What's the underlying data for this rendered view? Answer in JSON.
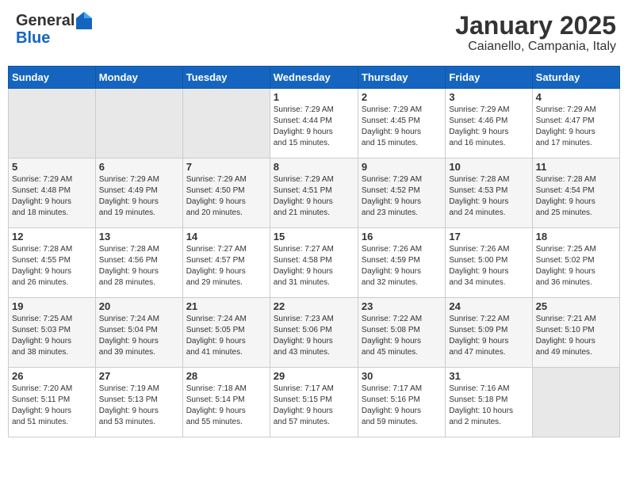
{
  "header": {
    "logo_general": "General",
    "logo_blue": "Blue",
    "title": "January 2025",
    "subtitle": "Caianello, Campania, Italy"
  },
  "calendar": {
    "days_of_week": [
      "Sunday",
      "Monday",
      "Tuesday",
      "Wednesday",
      "Thursday",
      "Friday",
      "Saturday"
    ],
    "weeks": [
      [
        {
          "day": "",
          "info": ""
        },
        {
          "day": "",
          "info": ""
        },
        {
          "day": "",
          "info": ""
        },
        {
          "day": "1",
          "info": "Sunrise: 7:29 AM\nSunset: 4:44 PM\nDaylight: 9 hours\nand 15 minutes."
        },
        {
          "day": "2",
          "info": "Sunrise: 7:29 AM\nSunset: 4:45 PM\nDaylight: 9 hours\nand 15 minutes."
        },
        {
          "day": "3",
          "info": "Sunrise: 7:29 AM\nSunset: 4:46 PM\nDaylight: 9 hours\nand 16 minutes."
        },
        {
          "day": "4",
          "info": "Sunrise: 7:29 AM\nSunset: 4:47 PM\nDaylight: 9 hours\nand 17 minutes."
        }
      ],
      [
        {
          "day": "5",
          "info": "Sunrise: 7:29 AM\nSunset: 4:48 PM\nDaylight: 9 hours\nand 18 minutes."
        },
        {
          "day": "6",
          "info": "Sunrise: 7:29 AM\nSunset: 4:49 PM\nDaylight: 9 hours\nand 19 minutes."
        },
        {
          "day": "7",
          "info": "Sunrise: 7:29 AM\nSunset: 4:50 PM\nDaylight: 9 hours\nand 20 minutes."
        },
        {
          "day": "8",
          "info": "Sunrise: 7:29 AM\nSunset: 4:51 PM\nDaylight: 9 hours\nand 21 minutes."
        },
        {
          "day": "9",
          "info": "Sunrise: 7:29 AM\nSunset: 4:52 PM\nDaylight: 9 hours\nand 23 minutes."
        },
        {
          "day": "10",
          "info": "Sunrise: 7:28 AM\nSunset: 4:53 PM\nDaylight: 9 hours\nand 24 minutes."
        },
        {
          "day": "11",
          "info": "Sunrise: 7:28 AM\nSunset: 4:54 PM\nDaylight: 9 hours\nand 25 minutes."
        }
      ],
      [
        {
          "day": "12",
          "info": "Sunrise: 7:28 AM\nSunset: 4:55 PM\nDaylight: 9 hours\nand 26 minutes."
        },
        {
          "day": "13",
          "info": "Sunrise: 7:28 AM\nSunset: 4:56 PM\nDaylight: 9 hours\nand 28 minutes."
        },
        {
          "day": "14",
          "info": "Sunrise: 7:27 AM\nSunset: 4:57 PM\nDaylight: 9 hours\nand 29 minutes."
        },
        {
          "day": "15",
          "info": "Sunrise: 7:27 AM\nSunset: 4:58 PM\nDaylight: 9 hours\nand 31 minutes."
        },
        {
          "day": "16",
          "info": "Sunrise: 7:26 AM\nSunset: 4:59 PM\nDaylight: 9 hours\nand 32 minutes."
        },
        {
          "day": "17",
          "info": "Sunrise: 7:26 AM\nSunset: 5:00 PM\nDaylight: 9 hours\nand 34 minutes."
        },
        {
          "day": "18",
          "info": "Sunrise: 7:25 AM\nSunset: 5:02 PM\nDaylight: 9 hours\nand 36 minutes."
        }
      ],
      [
        {
          "day": "19",
          "info": "Sunrise: 7:25 AM\nSunset: 5:03 PM\nDaylight: 9 hours\nand 38 minutes."
        },
        {
          "day": "20",
          "info": "Sunrise: 7:24 AM\nSunset: 5:04 PM\nDaylight: 9 hours\nand 39 minutes."
        },
        {
          "day": "21",
          "info": "Sunrise: 7:24 AM\nSunset: 5:05 PM\nDaylight: 9 hours\nand 41 minutes."
        },
        {
          "day": "22",
          "info": "Sunrise: 7:23 AM\nSunset: 5:06 PM\nDaylight: 9 hours\nand 43 minutes."
        },
        {
          "day": "23",
          "info": "Sunrise: 7:22 AM\nSunset: 5:08 PM\nDaylight: 9 hours\nand 45 minutes."
        },
        {
          "day": "24",
          "info": "Sunrise: 7:22 AM\nSunset: 5:09 PM\nDaylight: 9 hours\nand 47 minutes."
        },
        {
          "day": "25",
          "info": "Sunrise: 7:21 AM\nSunset: 5:10 PM\nDaylight: 9 hours\nand 49 minutes."
        }
      ],
      [
        {
          "day": "26",
          "info": "Sunrise: 7:20 AM\nSunset: 5:11 PM\nDaylight: 9 hours\nand 51 minutes."
        },
        {
          "day": "27",
          "info": "Sunrise: 7:19 AM\nSunset: 5:13 PM\nDaylight: 9 hours\nand 53 minutes."
        },
        {
          "day": "28",
          "info": "Sunrise: 7:18 AM\nSunset: 5:14 PM\nDaylight: 9 hours\nand 55 minutes."
        },
        {
          "day": "29",
          "info": "Sunrise: 7:17 AM\nSunset: 5:15 PM\nDaylight: 9 hours\nand 57 minutes."
        },
        {
          "day": "30",
          "info": "Sunrise: 7:17 AM\nSunset: 5:16 PM\nDaylight: 9 hours\nand 59 minutes."
        },
        {
          "day": "31",
          "info": "Sunrise: 7:16 AM\nSunset: 5:18 PM\nDaylight: 10 hours\nand 2 minutes."
        },
        {
          "day": "",
          "info": ""
        }
      ]
    ]
  }
}
